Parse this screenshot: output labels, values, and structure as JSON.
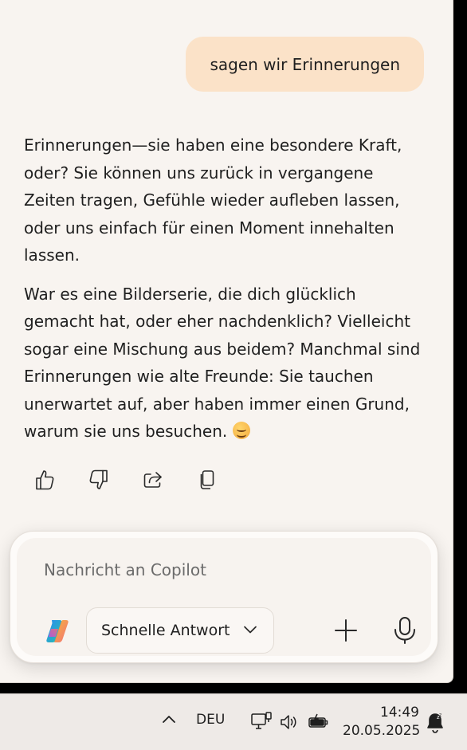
{
  "conversation": {
    "user_message": "sagen wir Erinnerungen",
    "assistant_paragraphs": [
      "Erinnerungen—sie haben eine besondere Kraft, oder? Sie können uns zurück in vergangene Zeiten tragen, Gefühle wieder aufleben lassen, oder uns einfach für einen Moment innehalten lassen.",
      "War es eine Bilderserie, die dich glücklich gemacht hat, oder eher nachdenklich? Vielleicht sogar eine Mischung aus beidem? Manchmal sind Erinnerungen wie alte Freunde: Sie tauchen unerwartet auf, aber haben immer einen Grund, warum sie uns besuchen."
    ],
    "emoji": "smiling-face-icon"
  },
  "message_actions": {
    "icons": [
      "thumbs-up-icon",
      "thumbs-down-icon",
      "share-icon",
      "copy-icon"
    ]
  },
  "composer": {
    "placeholder": "Nachricht an Copilot",
    "value": "",
    "mode_label": "Schnelle Antwort",
    "icons": [
      "copilot-logo-icon",
      "chevron-down-icon",
      "plus-icon",
      "microphone-icon"
    ]
  },
  "taskbar": {
    "language": "DEU",
    "time": "14:49",
    "date": "20.05.2025",
    "icons": [
      "chevron-up-icon",
      "network-icon",
      "speaker-icon",
      "battery-icon",
      "notification-icon"
    ]
  },
  "colors": {
    "window_bg": "#f8f4f0",
    "user_bubble": "#fbe2c8",
    "text": "#1f1f1f",
    "taskbar_bg": "#eeeae7"
  }
}
